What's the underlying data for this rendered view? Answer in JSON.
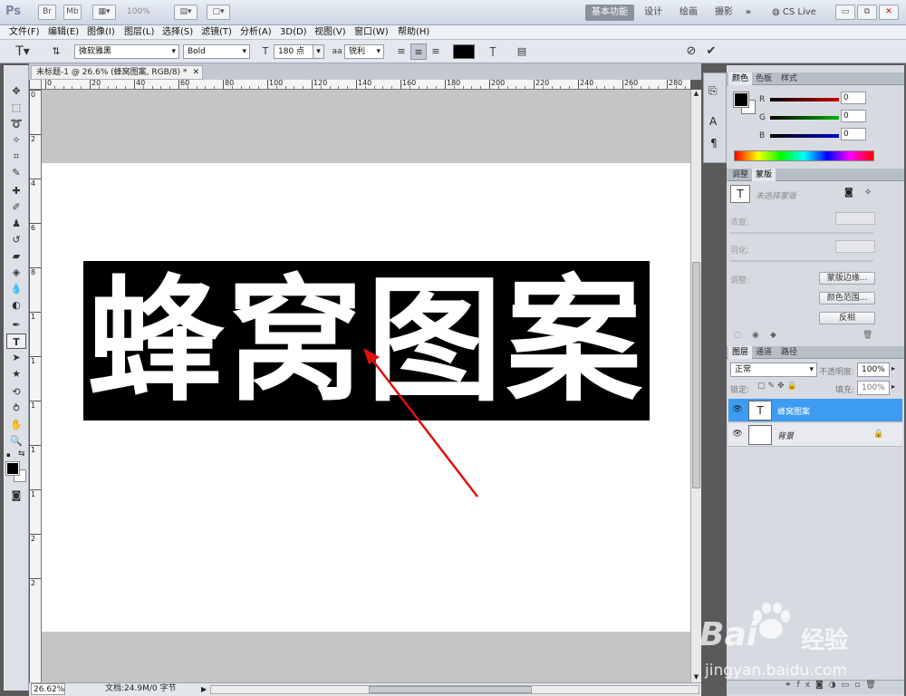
{
  "titlebar": {
    "ps_logo": "Ps",
    "zoom_select": "100%",
    "workspaces": [
      "基本功能",
      "设计",
      "绘画",
      "摄影"
    ],
    "more": "»",
    "cs_live": "CS Live"
  },
  "menu": [
    "文件(F)",
    "编辑(E)",
    "图像(I)",
    "图层(L)",
    "选择(S)",
    "滤镜(T)",
    "分析(A)",
    "3D(D)",
    "视图(V)",
    "窗口(W)",
    "帮助(H)"
  ],
  "options": {
    "font_family": "微软雅黑",
    "font_style": "Bold",
    "font_size": "180 点",
    "aa_label": "aa",
    "antialias": "锐利",
    "text_color": "#000000",
    "cancel_icon": "cancel-icon",
    "commit_icon": "commit-icon"
  },
  "document": {
    "tab_title": "未标题-1 @ 26.6% (蜂窝图案, RGB/8) *",
    "canvas_text": "蜂窝图案",
    "ruler_h": [
      "0",
      "20",
      "40",
      "60",
      "80",
      "100",
      "120",
      "140",
      "160",
      "180",
      "200",
      "220",
      "240",
      "260",
      "280"
    ],
    "ruler_v": [
      "0",
      "2",
      "4",
      "6",
      "8",
      "1",
      "1",
      "1",
      "1",
      "1",
      "2",
      "2"
    ],
    "zoom": "26.62%",
    "doc_info": "文档:24.9M/0 字节"
  },
  "color_panel": {
    "tabs": [
      "颜色",
      "色板",
      "样式"
    ],
    "channels": [
      {
        "label": "R",
        "value": "0",
        "color": "#cc0000"
      },
      {
        "label": "G",
        "value": "0",
        "color": "#00b000"
      },
      {
        "label": "B",
        "value": "0",
        "color": "#0000cc"
      }
    ]
  },
  "masks_panel": {
    "tabs": [
      "调整",
      "蒙版"
    ],
    "no_mask": "未选择蒙版",
    "density": "浓度:",
    "feather": "羽化:",
    "refine": "调整:",
    "btn_edge": "蒙版边缘...",
    "btn_range": "颜色范围...",
    "btn_invert": "反相"
  },
  "layers_panel": {
    "tabs": [
      "图层",
      "通道",
      "路径"
    ],
    "blend_mode": "正常",
    "opacity_label": "不透明度:",
    "opacity": "100%",
    "lock_label": "锁定:",
    "fill_label": "填充:",
    "fill": "100%",
    "layers": [
      {
        "name": "蜂窝图案",
        "thumb": "T",
        "selected": true
      },
      {
        "name": "背景",
        "thumb": "",
        "selected": false
      }
    ]
  },
  "watermark": {
    "brand": "Bai",
    "brand2": "经验",
    "url": "jingyan.baidu.com"
  }
}
